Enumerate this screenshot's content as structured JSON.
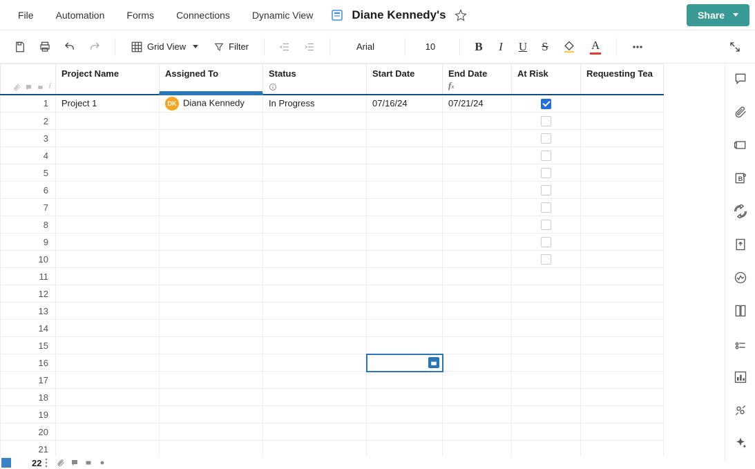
{
  "menubar": {
    "items": [
      "File",
      "Automation",
      "Forms",
      "Connections",
      "Dynamic View"
    ],
    "sheet_title": "Diane Kennedy's",
    "share_label": "Share"
  },
  "toolbar": {
    "view_label": "Grid View",
    "filter_label": "Filter",
    "font": "Arial",
    "font_size": "10"
  },
  "columns": [
    {
      "key": "project",
      "label": "Project Name"
    },
    {
      "key": "assigned",
      "label": "Assigned To",
      "selected": true
    },
    {
      "key": "status",
      "label": "Status",
      "info": true
    },
    {
      "key": "start",
      "label": "Start Date"
    },
    {
      "key": "end",
      "label": "End Date",
      "fx": true
    },
    {
      "key": "risk",
      "label": "At Risk"
    },
    {
      "key": "req",
      "label": "Requesting Tea"
    }
  ],
  "rows": [
    {
      "n": 1,
      "project": "Project 1",
      "assigned": {
        "avatar": "DK",
        "name": "Diana Kennedy"
      },
      "status": "In Progress",
      "start": "07/16/24",
      "end": "07/21/24",
      "risk": true
    },
    {
      "n": 2,
      "risk": false
    },
    {
      "n": 3,
      "risk": false
    },
    {
      "n": 4,
      "risk": false
    },
    {
      "n": 5,
      "risk": false
    },
    {
      "n": 6,
      "risk": false
    },
    {
      "n": 7,
      "risk": false
    },
    {
      "n": 8,
      "risk": false
    },
    {
      "n": 9,
      "risk": false
    },
    {
      "n": 10,
      "risk": false
    },
    {
      "n": 11
    },
    {
      "n": 12
    },
    {
      "n": 13
    },
    {
      "n": 14
    },
    {
      "n": 15
    },
    {
      "n": 16,
      "active_col": "start"
    },
    {
      "n": 17
    },
    {
      "n": 18
    },
    {
      "n": 19
    },
    {
      "n": 20
    },
    {
      "n": 21
    }
  ],
  "bottom": {
    "rownum": "22"
  }
}
